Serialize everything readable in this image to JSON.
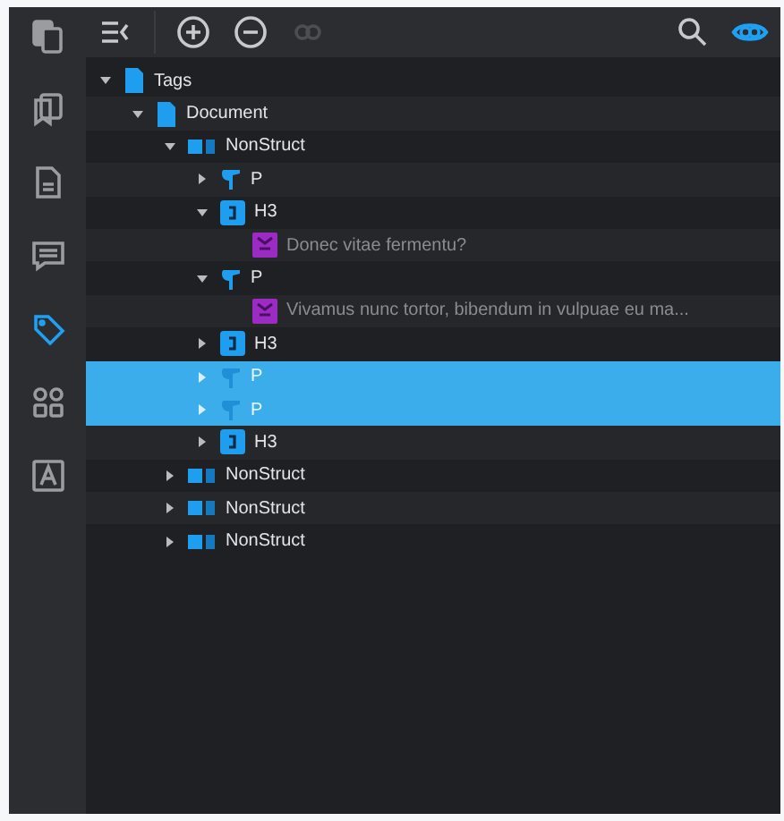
{
  "sidebar": {
    "items": [
      {
        "kind": "pages",
        "selected": false
      },
      {
        "kind": "bookmarks",
        "selected": false
      },
      {
        "kind": "document",
        "selected": false
      },
      {
        "kind": "comments",
        "selected": false
      },
      {
        "kind": "tags",
        "selected": true
      },
      {
        "kind": "layout",
        "selected": false
      },
      {
        "kind": "text-field",
        "selected": false
      }
    ]
  },
  "toolbar": [
    {
      "kind": "collapse-panel",
      "disabled": false,
      "on": false
    },
    {
      "kind": "add",
      "disabled": false,
      "on": false
    },
    {
      "kind": "remove",
      "disabled": false,
      "on": false
    },
    {
      "kind": "link",
      "disabled": true,
      "on": false
    },
    {
      "kind": "search",
      "disabled": false,
      "on": false
    },
    {
      "kind": "eye",
      "disabled": false,
      "on": true
    }
  ],
  "tree": [
    {
      "kind": "document",
      "label": "Tags",
      "expanded": true,
      "selected": false,
      "children": [
        {
          "kind": "document",
          "label": "Document",
          "expanded": true,
          "selected": false,
          "children": [
            {
              "kind": "nonstruct",
              "label": "NonStruct",
              "expanded": true,
              "selected": false,
              "children": [
                {
                  "kind": "paragraph",
                  "label": "P",
                  "expanded": false,
                  "selected": false
                },
                {
                  "kind": "heading",
                  "label": "H3",
                  "expanded": true,
                  "selected": false,
                  "children": [
                    {
                      "kind": "content",
                      "label": "Donec vitae fermentu?",
                      "selected": false
                    }
                  ]
                },
                {
                  "kind": "paragraph",
                  "label": "P",
                  "expanded": true,
                  "selected": false,
                  "children": [
                    {
                      "kind": "content",
                      "label": "Vivamus nunc tortor, bibendum in vulpuae eu ma...",
                      "selected": false
                    }
                  ]
                },
                {
                  "kind": "heading",
                  "label": "H3",
                  "expanded": false,
                  "selected": false
                },
                {
                  "kind": "paragraph",
                  "label": "P",
                  "expanded": false,
                  "selected": true
                },
                {
                  "kind": "paragraph",
                  "label": "P",
                  "expanded": false,
                  "selected": true
                },
                {
                  "kind": "heading",
                  "label": "H3",
                  "expanded": false,
                  "selected": false
                }
              ]
            },
            {
              "kind": "nonstruct",
              "label": "NonStruct",
              "expanded": false,
              "selected": false
            },
            {
              "kind": "nonstruct",
              "label": "NonStruct",
              "expanded": false,
              "selected": false
            },
            {
              "kind": "nonstruct",
              "label": "NonStruct",
              "expanded": false,
              "selected": false
            }
          ]
        }
      ]
    }
  ]
}
